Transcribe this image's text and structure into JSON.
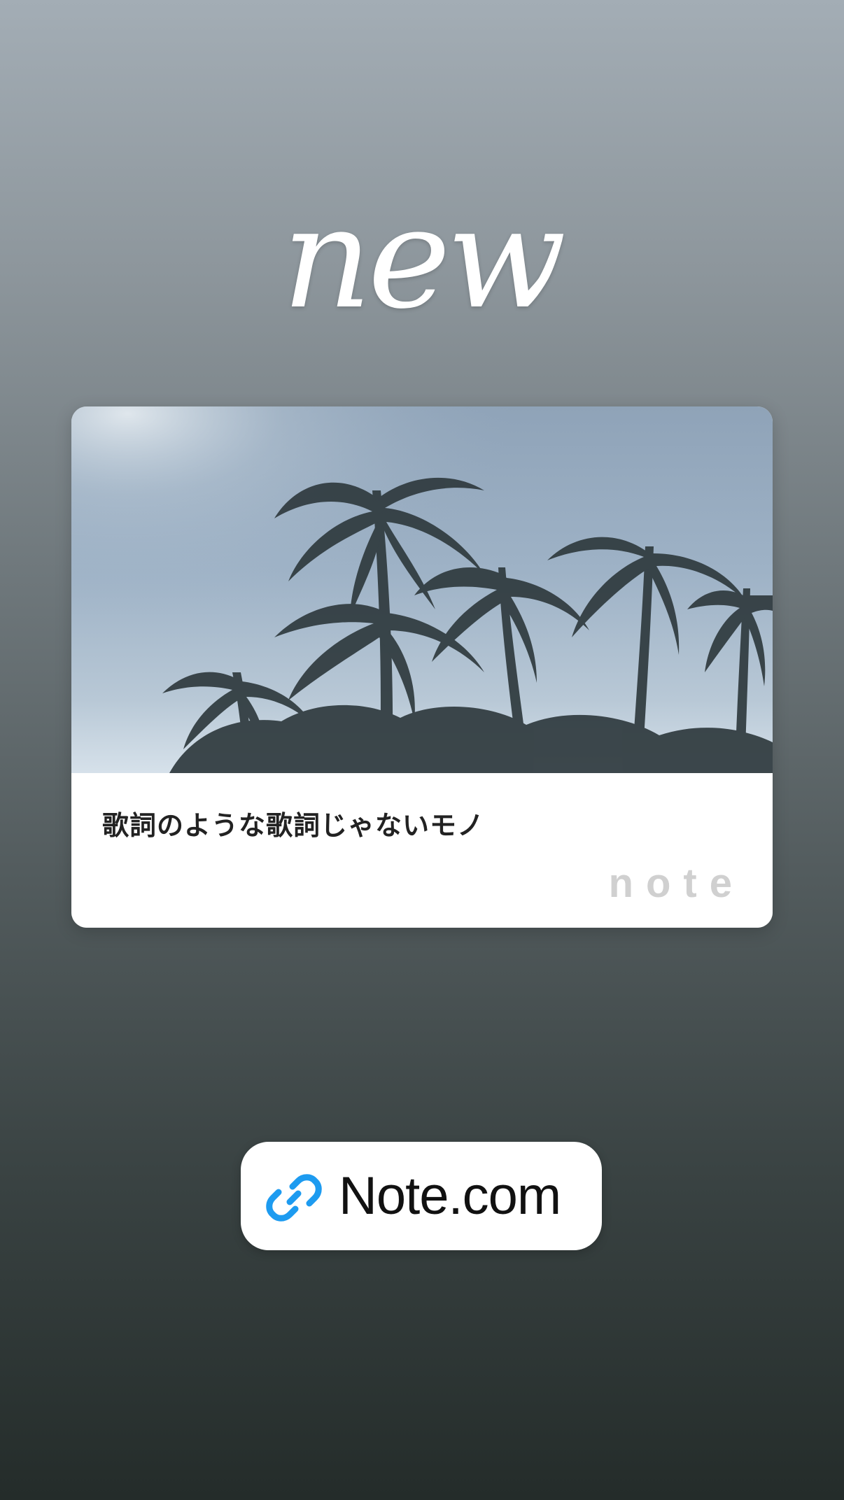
{
  "story": {
    "title_text": "new"
  },
  "card": {
    "title": "歌詞のような歌詞じゃないモノ",
    "brand": "note",
    "image_description_icon": "palm-trees-photo"
  },
  "link_sticker": {
    "icon": "link-icon",
    "label": "Note.com",
    "icon_color": "#1d9bf0"
  }
}
